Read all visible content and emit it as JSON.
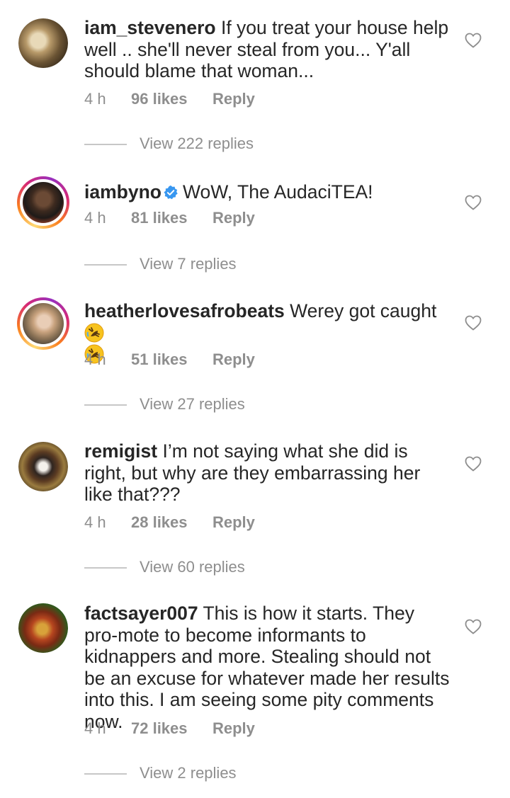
{
  "comments": [
    {
      "username": "iam_stevenero",
      "text": " If you treat your house help well .. she'll never steal from you... Y'all should blame that woman...",
      "time": "4 h",
      "likes": "96 likes",
      "reply": "Reply",
      "view_replies": "View 222 replies"
    },
    {
      "username": "iambyno",
      "text": "WoW, The AudaciTEA!",
      "time": "4 h",
      "likes": "81 likes",
      "reply": "Reply",
      "view_replies": "View 7 replies"
    },
    {
      "username": "heatherlovesafrobeats",
      "text": " Werey got caught ",
      "time": "4 h",
      "likes": "51 likes",
      "reply": "Reply",
      "view_replies": "View 27 replies"
    },
    {
      "username": "remigist",
      "text": " I’m not saying what she did is right, but why are they embarrassing her like that???",
      "time": "4 h",
      "likes": "28 likes",
      "reply": "Reply",
      "view_replies": "View 60 replies"
    },
    {
      "username": "factsayer007",
      "text": " This is how it starts. They pro-mote to become informants to kidnappers and more. Stealing should not be an excuse for whatever made her results into this. I am seeing some pity comments now.",
      "time": "4 h",
      "likes": "72 likes",
      "reply": "Reply",
      "view_replies": "View 2 replies"
    }
  ],
  "icons": {
    "heart": "heart-outline-icon",
    "verified": "verified-badge-icon",
    "emoji": "rolling-laughing-emoji-icon"
  },
  "colors": {
    "text": "#262626",
    "secondary": "#8e8e8e",
    "verified": "#3897f0"
  }
}
